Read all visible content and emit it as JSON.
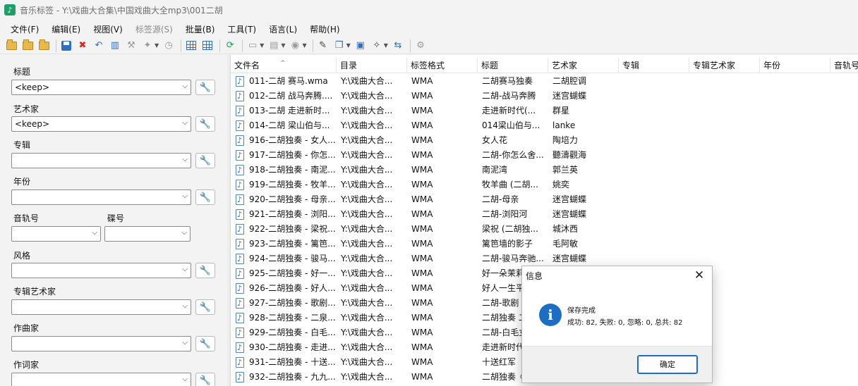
{
  "window": {
    "app_icon": "music-note-icon",
    "title": "音乐标签 - Y:\\戏曲大合集\\中国戏曲大全mp3\\001二胡"
  },
  "menu": [
    {
      "label": "文件(F)",
      "enabled": true
    },
    {
      "label": "编辑(E)",
      "enabled": true
    },
    {
      "label": "视图(V)",
      "enabled": true
    },
    {
      "label": "标签源(S)",
      "enabled": false
    },
    {
      "label": "批量(B)",
      "enabled": true
    },
    {
      "label": "工具(T)",
      "enabled": true
    },
    {
      "label": "语言(L)",
      "enabled": true
    },
    {
      "label": "帮助(H)",
      "enabled": true
    }
  ],
  "fields": {
    "title": {
      "label": "标题",
      "value": "<keep>"
    },
    "artist": {
      "label": "艺术家",
      "value": "<keep>"
    },
    "album": {
      "label": "专辑",
      "value": ""
    },
    "year": {
      "label": "年份",
      "value": ""
    },
    "track": {
      "label": "音轨号",
      "value": ""
    },
    "disc": {
      "label": "碟号",
      "value": ""
    },
    "genre": {
      "label": "风格",
      "value": ""
    },
    "album_artist": {
      "label": "专辑艺术家",
      "value": ""
    },
    "composer": {
      "label": "作曲家",
      "value": ""
    },
    "lyricist": {
      "label": "作词家",
      "value": ""
    }
  },
  "table": {
    "columns": [
      "文件名",
      "目录",
      "标签格式",
      "标题",
      "艺术家",
      "专辑",
      "专辑艺术家",
      "年份",
      "音轨号"
    ],
    "rows": [
      {
        "file": "011-二胡 赛马.wma",
        "dir": "Y:\\戏曲大合...",
        "fmt": "WMA",
        "title": "二胡赛马独奏",
        "artist": "二胡腔调"
      },
      {
        "file": "012-二胡 战马奔腾....",
        "dir": "Y:\\戏曲大合...",
        "fmt": "WMA",
        "title": "二胡-战马奔腾",
        "artist": "迷宫蝴蝶"
      },
      {
        "file": "013-二胡 走进新时...",
        "dir": "Y:\\戏曲大合...",
        "fmt": "WMA",
        "title": "走进新时代(...",
        "artist": "群星"
      },
      {
        "file": "014-二胡 梁山伯与...",
        "dir": "Y:\\戏曲大合...",
        "fmt": "WMA",
        "title": "014梁山伯与...",
        "artist": "lanke"
      },
      {
        "file": "916-二胡独奏 - 女人...",
        "dir": "Y:\\戏曲大合...",
        "fmt": "WMA",
        "title": "女人花",
        "artist": "陶培力"
      },
      {
        "file": "917-二胡独奏 - 你怎...",
        "dir": "Y:\\戏曲大合...",
        "fmt": "WMA",
        "title": "二胡-你怎么舍...",
        "artist": "聽濤觀海"
      },
      {
        "file": "918-二胡独奏 - 南泥...",
        "dir": "Y:\\戏曲大合...",
        "fmt": "WMA",
        "title": "南泥湾",
        "artist": "郭兰英"
      },
      {
        "file": "919-二胡独奏 - 牧羊...",
        "dir": "Y:\\戏曲大合...",
        "fmt": "WMA",
        "title": "牧羊曲 (二胡...",
        "artist": "姚奕"
      },
      {
        "file": "920-二胡独奏 - 母亲...",
        "dir": "Y:\\戏曲大合...",
        "fmt": "WMA",
        "title": "二胡-母亲",
        "artist": "迷宫蝴蝶"
      },
      {
        "file": "921-二胡独奏 - 浏阳...",
        "dir": "Y:\\戏曲大合...",
        "fmt": "WMA",
        "title": "二胡-浏阳河",
        "artist": "迷宫蝴蝶"
      },
      {
        "file": "922-二胡独奏 - 梁祝...",
        "dir": "Y:\\戏曲大合...",
        "fmt": "WMA",
        "title": "梁祝 (二胡独...",
        "artist": "城沐西"
      },
      {
        "file": "923-二胡独奏 - 篱笆...",
        "dir": "Y:\\戏曲大合...",
        "fmt": "WMA",
        "title": "篱笆墙的影子",
        "artist": "毛阿敏"
      },
      {
        "file": "924-二胡独奏 - 骏马...",
        "dir": "Y:\\戏曲大合...",
        "fmt": "WMA",
        "title": "二胡-骏马奔驰...",
        "artist": "迷宫蝴蝶"
      },
      {
        "file": "925-二胡独奏 - 好一...",
        "dir": "Y:\\戏曲大合...",
        "fmt": "WMA",
        "title": "好一朵茉莉",
        "artist": ""
      },
      {
        "file": "926-二胡独奏 - 好人...",
        "dir": "Y:\\戏曲大合...",
        "fmt": "WMA",
        "title": "好人一生平",
        "artist": ""
      },
      {
        "file": "927-二胡独奏 - 歌剧...",
        "dir": "Y:\\戏曲大合...",
        "fmt": "WMA",
        "title": "二胡-歌剧",
        "artist": ""
      },
      {
        "file": "928-二胡独奏 - 二泉...",
        "dir": "Y:\\戏曲大合...",
        "fmt": "WMA",
        "title": "二胡独奏 二",
        "artist": ""
      },
      {
        "file": "929-二胡独奏 - 白毛...",
        "dir": "Y:\\戏曲大合...",
        "fmt": "WMA",
        "title": "二胡-白毛女",
        "artist": ""
      },
      {
        "file": "930-二胡独奏 - 走进...",
        "dir": "Y:\\戏曲大合...",
        "fmt": "WMA",
        "title": "走进新时代",
        "artist": ""
      },
      {
        "file": "931-二胡独奏 - 十送...",
        "dir": "Y:\\戏曲大合...",
        "fmt": "WMA",
        "title": "十送红军",
        "artist": ""
      },
      {
        "file": "932-二胡独奏 - 九九...",
        "dir": "Y:\\戏曲大合...",
        "fmt": "WMA",
        "title": "二胡独奏《",
        "artist": ""
      }
    ]
  },
  "dialog": {
    "title": "信息",
    "heading": "保存完成",
    "message": "成功: 82, 失败: 0, 忽略: 0, 总共: 82",
    "ok_label": "确定"
  },
  "colors": {
    "accent": "#1c6dc4",
    "folder": "#e8b94a",
    "delete": "#d8291e"
  }
}
